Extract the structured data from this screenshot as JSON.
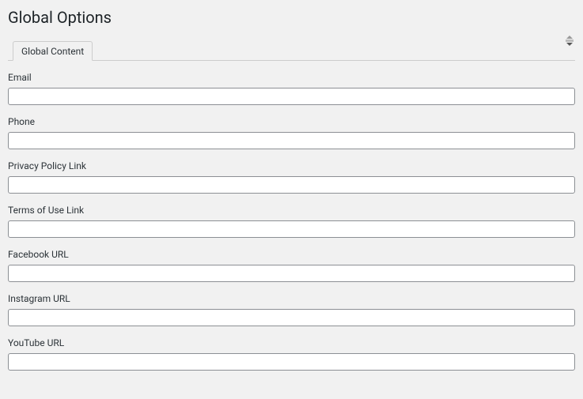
{
  "page": {
    "title": "Global Options"
  },
  "tabs": {
    "active": "Global Content"
  },
  "fields": {
    "email": {
      "label": "Email",
      "value": ""
    },
    "phone": {
      "label": "Phone",
      "value": ""
    },
    "privacy": {
      "label": "Privacy Policy Link",
      "value": ""
    },
    "terms": {
      "label": "Terms of Use Link",
      "value": ""
    },
    "facebook": {
      "label": "Facebook URL",
      "value": ""
    },
    "instagram": {
      "label": "Instagram URL",
      "value": ""
    },
    "youtube": {
      "label": "YouTube URL",
      "value": ""
    }
  }
}
